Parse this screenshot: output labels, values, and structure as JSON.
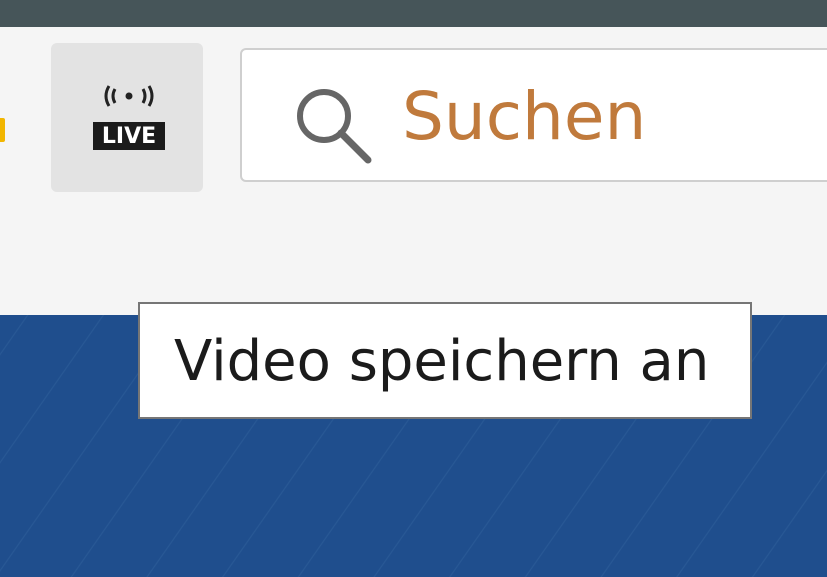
{
  "live_button": {
    "icon": "live-broadcast-icon",
    "icon_text": "LIVE"
  },
  "search": {
    "placeholder": "Suchen",
    "value": "",
    "icon": "search-icon"
  },
  "tooltip": {
    "text": "Video speichern an"
  },
  "colors": {
    "title_strip": "#465559",
    "toolbar_bg": "#f5f5f5",
    "live_button_bg": "#e3e3e3",
    "search_placeholder": "#c07a3c",
    "banner": "#1f4e8d",
    "accent_marker": "#f2b600"
  }
}
